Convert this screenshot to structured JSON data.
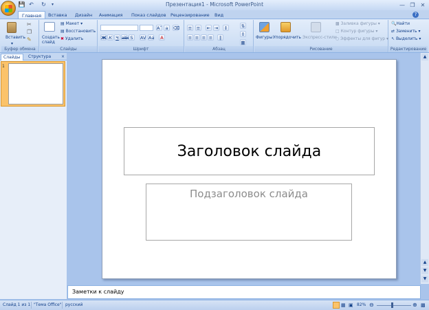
{
  "window": {
    "title": "Презентация1 - Microsoft PowerPoint"
  },
  "qat": {
    "save_icon": "save-icon",
    "undo_icon": "undo-icon",
    "redo_icon": "redo-icon"
  },
  "tabs": [
    {
      "label": "Главная",
      "active": true
    },
    {
      "label": "Вставка"
    },
    {
      "label": "Дизайн"
    },
    {
      "label": "Анимация"
    },
    {
      "label": "Показ слайдов"
    },
    {
      "label": "Рецензирование"
    },
    {
      "label": "Вид"
    }
  ],
  "ribbon": {
    "clipboard": {
      "label": "Буфер обмена",
      "paste": "Вставить"
    },
    "slides": {
      "label": "Слайды",
      "new_slide": "Создать слайд",
      "layout": "Макет",
      "reset": "Восстановить",
      "delete": "Удалить"
    },
    "font": {
      "label": "Шрифт",
      "font_name": "",
      "font_size": ""
    },
    "paragraph": {
      "label": "Абзац"
    },
    "drawing": {
      "label": "Рисование",
      "shapes": "Фигуры",
      "arrange": "Упорядочить",
      "quick_styles": "Экспресс-стили",
      "fill": "Заливка фигуры",
      "outline": "Контур фигуры",
      "effects": "Эффекты для фигур"
    },
    "editing": {
      "label": "Редактирование",
      "find": "Найти",
      "replace": "Заменить",
      "select": "Выделить"
    }
  },
  "panel": {
    "tab_slides": "Слайды",
    "tab_outline": "Структура",
    "close": "×",
    "slide_num": "1"
  },
  "slide": {
    "title_placeholder": "Заголовок слайда",
    "subtitle_placeholder": "Подзаголовок слайда"
  },
  "notes": {
    "placeholder": "Заметки к слайду"
  },
  "status": {
    "slide": "Слайд 1 из 1",
    "theme": "\"Тема Office\"",
    "language": "русский",
    "zoom": "82%"
  },
  "colors": {
    "ribbon_bg": "#c7daf3",
    "accent": "#15428b",
    "selected_thumb": "#fbc36a"
  }
}
